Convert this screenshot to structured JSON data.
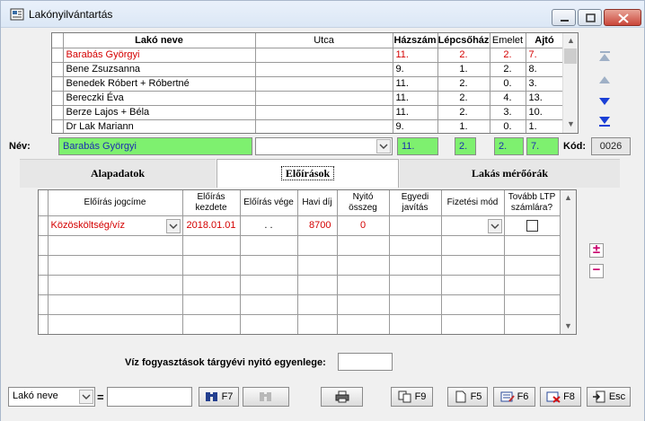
{
  "window": {
    "title": "Lakónyilvántartás"
  },
  "residents": {
    "columns": [
      "Lakó neve",
      "Utca",
      "Házszám",
      "Lépcsőház",
      "Emelet",
      "Ajtó"
    ],
    "rows": [
      {
        "name": "Barabás Györgyi",
        "street": "",
        "house": "11.",
        "stair": "2.",
        "floor": "2.",
        "door": "7.",
        "highlight": true
      },
      {
        "name": "Bene Zsuzsanna",
        "street": "",
        "house": "9.",
        "stair": "1.",
        "floor": "2.",
        "door": "8."
      },
      {
        "name": "Benedek Róbert + Róbertné",
        "street": "",
        "house": "11.",
        "stair": "2.",
        "floor": "0.",
        "door": "3."
      },
      {
        "name": "Bereczki Éva",
        "street": "",
        "house": "11.",
        "stair": "2.",
        "floor": "4.",
        "door": "13."
      },
      {
        "name": "Berze Lajos + Béla",
        "street": "",
        "house": "11.",
        "stair": "2.",
        "floor": "3.",
        "door": "10."
      },
      {
        "name": "Dr Lak Mariann",
        "street": "",
        "house": "9.",
        "stair": "1.",
        "floor": "0.",
        "door": "1."
      }
    ]
  },
  "record": {
    "name_label": "Név:",
    "name": "Barabás Györgyi",
    "street": "",
    "house": "11.",
    "stair": "2.",
    "floor": "2.",
    "door": "7.",
    "code_label": "Kód:",
    "code": "0026"
  },
  "tabs": [
    {
      "label": "Alapadatok",
      "active": false
    },
    {
      "label": "Előírások",
      "active": true
    },
    {
      "label": "Lakás mérőórák",
      "active": false
    }
  ],
  "prescriptions": {
    "columns": [
      "Előírás jogcíme",
      "Előírás\nkezdete",
      "Előírás vége",
      "Havi díj",
      "Nyitó\nösszeg",
      "Egyedi\njavítás",
      "Fizetési mód",
      "Tovább LTP\nszámlára?"
    ],
    "rows": [
      {
        "title": "Közösköltség/víz",
        "start": "2018.01.01",
        "end": " . .",
        "monthly": "8700",
        "opening": "0",
        "custom": "",
        "payment": "",
        "ltp": false
      }
    ]
  },
  "water": {
    "label": "Víz fogyasztások tárgyévi nyitó egyenlege:",
    "value": ""
  },
  "bottom": {
    "search_field": "Lakó neve",
    "eq": "=",
    "search_value": "",
    "f7": "F7",
    "f9": "F9",
    "f5": "F5",
    "f6": "F6",
    "f8": "F8",
    "esc": "Esc"
  }
}
